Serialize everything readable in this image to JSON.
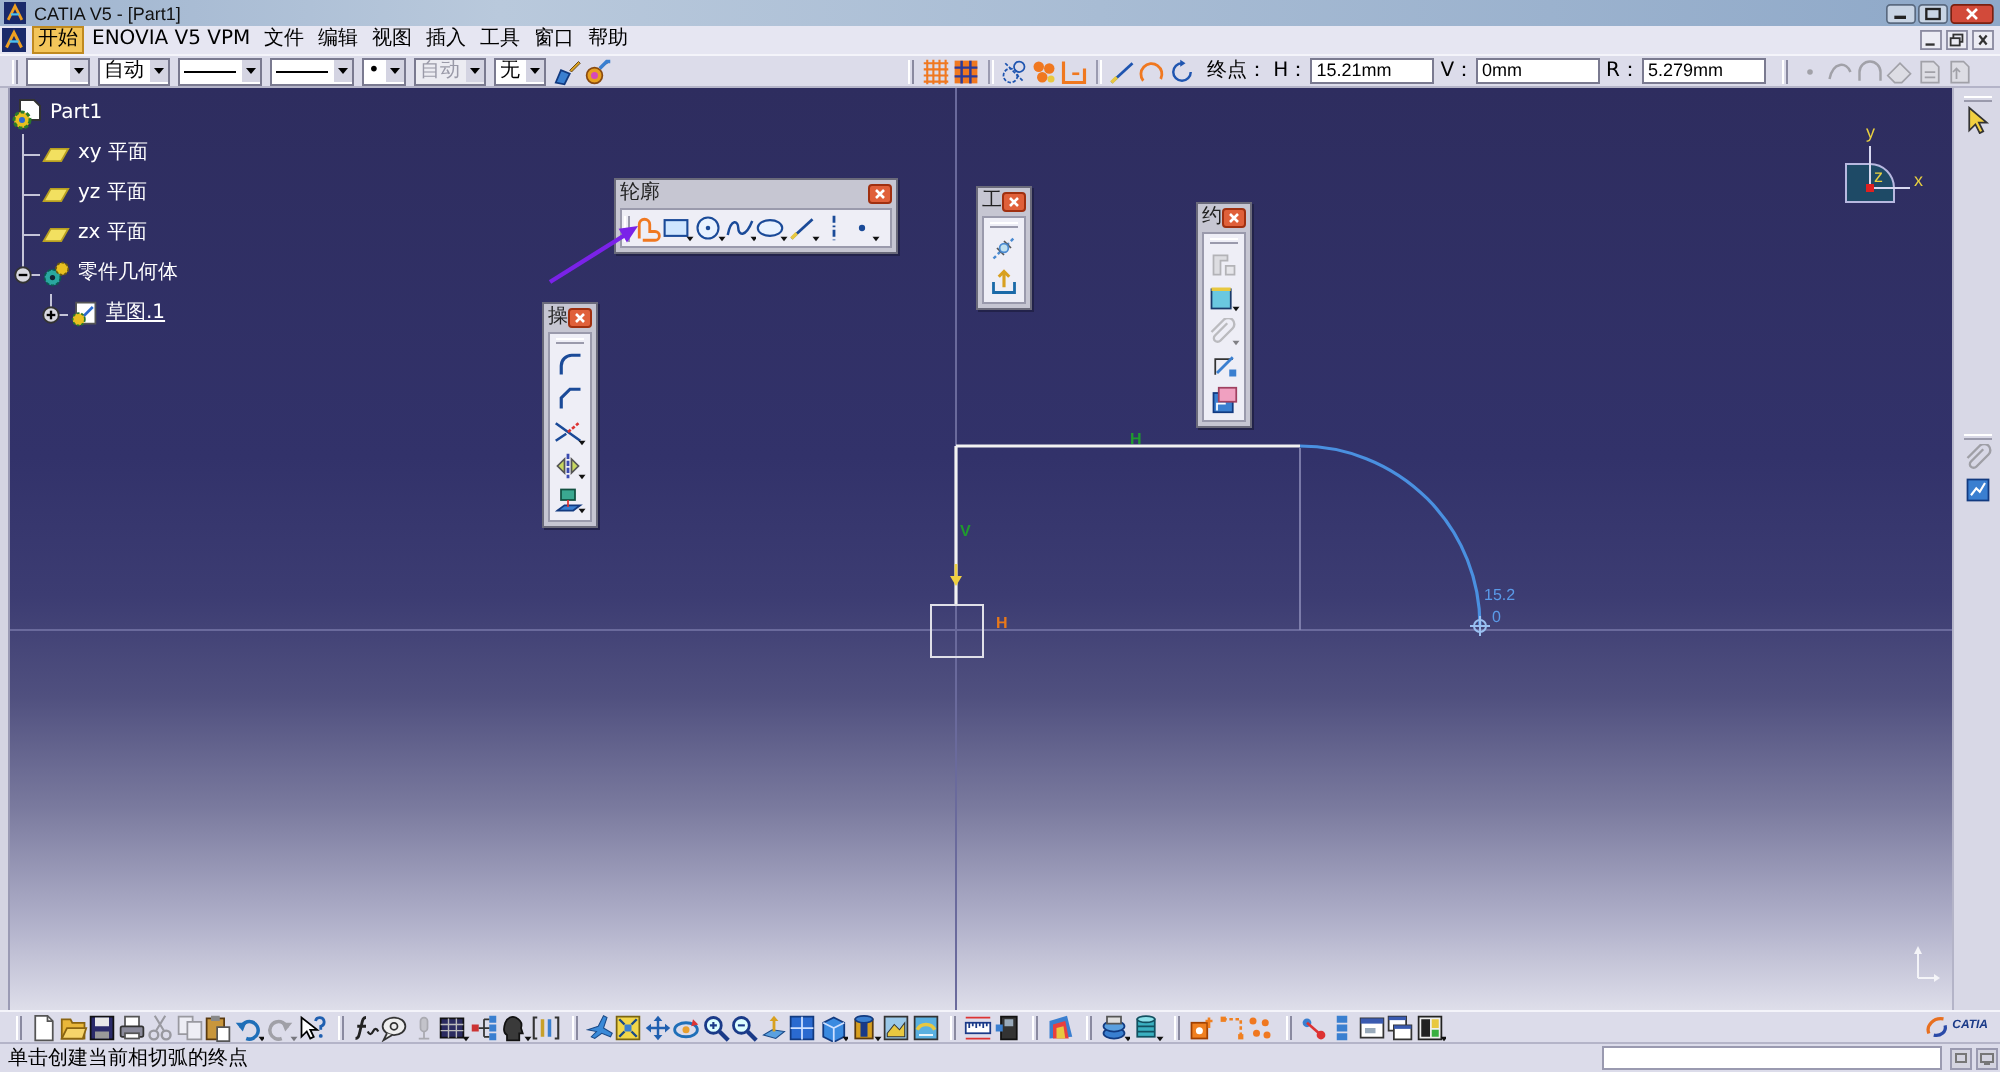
{
  "window": {
    "title": "CATIA V5 - [Part1]"
  },
  "menu_bar": {
    "items": [
      {
        "label": "开始",
        "selected": true
      },
      {
        "label": "ENOVIA V5 VPM",
        "selected": false
      },
      {
        "label": "文件",
        "selected": false
      },
      {
        "label": "编辑",
        "selected": false
      },
      {
        "label": "视图",
        "selected": false
      },
      {
        "label": "插入",
        "selected": false
      },
      {
        "label": "工具",
        "selected": false
      },
      {
        "label": "窗口",
        "selected": false
      },
      {
        "label": "帮助",
        "selected": false
      }
    ]
  },
  "properties_toolbar": {
    "dropdowns": [
      {
        "kind": "color",
        "disabled": false
      },
      {
        "kind": "text",
        "value": "自动",
        "disabled": false
      },
      {
        "kind": "line",
        "disabled": false
      },
      {
        "kind": "line",
        "disabled": false
      },
      {
        "kind": "text",
        "value": "•",
        "disabled": false
      },
      {
        "kind": "text",
        "value": "自动",
        "disabled": true
      },
      {
        "kind": "text",
        "value": "无",
        "disabled": false
      }
    ],
    "buttons": [
      {
        "kind": "brush"
      },
      {
        "kind": "painter"
      }
    ]
  },
  "sketch_tools_toolbar": {
    "groups": [
      {
        "buttons": [
          {
            "kind": "grid",
            "on": true
          },
          {
            "kind": "snap",
            "on": true
          }
        ]
      },
      {
        "buttons": [
          {
            "kind": "construction",
            "on": false
          },
          {
            "kind": "constraints",
            "on": true
          },
          {
            "kind": "dimensions",
            "on": true
          }
        ]
      },
      {
        "buttons": [
          {
            "kind": "line",
            "on": false
          },
          {
            "kind": "tangentarc",
            "on": true
          },
          {
            "kind": "threepointarc",
            "on": false
          }
        ]
      }
    ],
    "label": "终点：",
    "fields": [
      {
        "label": "H：",
        "value": "15.21mm"
      },
      {
        "label": "V：",
        "value": "0mm"
      },
      {
        "label": "R：",
        "value": "5.279mm"
      }
    ]
  },
  "edit_toolbar": {
    "buttons": [
      {
        "kind": "dot",
        "disabled": true
      },
      {
        "kind": "curve",
        "disabled": true
      },
      {
        "kind": "arch",
        "disabled": true
      },
      {
        "kind": "eraser",
        "disabled": true
      },
      {
        "kind": "pagefold",
        "disabled": true
      },
      {
        "kind": "pagearrow",
        "disabled": true
      }
    ]
  },
  "tree": {
    "label": "Part1",
    "kind": "part",
    "current": false,
    "children": [
      {
        "label": "xy 平面",
        "kind": "plane",
        "current": false
      },
      {
        "label": "yz 平面",
        "kind": "plane",
        "current": false
      },
      {
        "label": "zx 平面",
        "kind": "plane",
        "current": false
      },
      {
        "label": "零件几何体",
        "kind": "body",
        "current": false,
        "expanded": true,
        "children": [
          {
            "label": "草图.1",
            "kind": "sketch",
            "current": true,
            "expanded": false
          }
        ]
      }
    ]
  },
  "floating_toolbars": [
    {
      "title": "轮廓",
      "buttons": [
        {
          "kind": "profile",
          "selected": true
        },
        {
          "kind": "rectangle",
          "selected": false,
          "menu": true
        },
        {
          "kind": "circle",
          "selected": false,
          "menu": true
        },
        {
          "kind": "spline",
          "selected": false,
          "menu": true
        },
        {
          "kind": "ellipse",
          "selected": false,
          "menu": true
        },
        {
          "kind": "line",
          "selected": false,
          "menu": true
        },
        {
          "kind": "axis",
          "selected": false
        },
        {
          "kind": "point",
          "selected": false,
          "menu": true
        }
      ]
    },
    {
      "title": "工",
      "buttons": [
        {
          "kind": "constructionmode"
        },
        {
          "kind": "exit"
        }
      ]
    },
    {
      "title": "约",
      "buttons": [
        {
          "kind": "constraintdialog",
          "disabled": true
        },
        {
          "kind": "fixed",
          "disabled": false,
          "menu": true
        },
        {
          "kind": "contact",
          "disabled": true,
          "menu": true
        },
        {
          "kind": "editmulti",
          "disabled": false
        },
        {
          "kind": "autoconstraint",
          "disabled": false
        }
      ]
    },
    {
      "title": "操",
      "buttons": [
        {
          "kind": "fillet"
        },
        {
          "kind": "chamfer"
        },
        {
          "kind": "trim",
          "menu": true
        },
        {
          "kind": "mirror",
          "menu": true
        },
        {
          "kind": "project",
          "menu": true
        }
      ]
    }
  ],
  "sketch": {
    "constraints": [
      {
        "label": "H",
        "color": "#1f9a2e"
      },
      {
        "label": "V",
        "color": "#1f9a2e"
      },
      {
        "label": "H",
        "color": "#e8781a"
      }
    ],
    "readouts": [
      "15.2",
      "0"
    ]
  },
  "compass": {
    "x": "x",
    "y": "y",
    "z": "z"
  },
  "right_toolbar": {
    "groups": [
      {
        "buttons": [
          {
            "kind": "select",
            "disabled": false
          }
        ]
      },
      {
        "buttons": [
          {
            "kind": "clip",
            "disabled": true
          },
          {
            "kind": "analysis",
            "disabled": false
          }
        ]
      }
    ]
  },
  "bottom_toolbar": {
    "groups": [
      {
        "buttons": [
          {
            "kind": "new",
            "disabled": false
          },
          {
            "kind": "open",
            "disabled": false
          },
          {
            "kind": "save",
            "disabled": false
          },
          {
            "kind": "print",
            "disabled": false
          },
          {
            "kind": "cut",
            "disabled": true
          },
          {
            "kind": "copy",
            "disabled": true
          },
          {
            "kind": "paste",
            "disabled": false
          },
          {
            "kind": "undo",
            "disabled": false,
            "menu": true
          },
          {
            "kind": "redo",
            "disabled": true,
            "menu": true
          },
          {
            "kind": "whatsthis",
            "disabled": false
          }
        ]
      },
      {
        "buttons": [
          {
            "kind": "formula",
            "disabled": false
          },
          {
            "kind": "comment",
            "disabled": false
          },
          {
            "kind": "mic",
            "disabled": true
          },
          {
            "kind": "table",
            "disabled": false,
            "menu": true
          },
          {
            "kind": "network",
            "disabled": false
          },
          {
            "kind": "head",
            "disabled": false,
            "menu": true
          },
          {
            "kind": "split",
            "disabled": false
          }
        ]
      },
      {
        "buttons": [
          {
            "kind": "fly",
            "disabled": false
          },
          {
            "kind": "fitall",
            "disabled": false
          },
          {
            "kind": "pan",
            "disabled": false
          },
          {
            "kind": "rotate",
            "disabled": false
          },
          {
            "kind": "zoomin",
            "disabled": false
          },
          {
            "kind": "zoomout",
            "disabled": false
          },
          {
            "kind": "normal",
            "disabled": false
          },
          {
            "kind": "multiview",
            "disabled": false
          },
          {
            "kind": "cube",
            "disabled": false,
            "menu": true
          },
          {
            "kind": "shading",
            "disabled": false,
            "menu": true
          },
          {
            "kind": "hideshow",
            "disabled": false
          },
          {
            "kind": "swap",
            "disabled": false
          }
        ]
      },
      {
        "buttons": [
          {
            "kind": "measure",
            "disabled": false
          },
          {
            "kind": "device",
            "disabled": false
          }
        ]
      },
      {
        "buttons": [
          {
            "kind": "palette",
            "disabled": false
          }
        ]
      },
      {
        "buttons": [
          {
            "kind": "disk",
            "disabled": false,
            "menu": true
          },
          {
            "kind": "cylinders",
            "disabled": false,
            "menu": true
          }
        ]
      },
      {
        "buttons": [
          {
            "kind": "block",
            "disabled": false
          },
          {
            "kind": "corner",
            "disabled": false
          },
          {
            "kind": "points",
            "disabled": false
          }
        ]
      },
      {
        "buttons": [
          {
            "kind": "node",
            "disabled": false
          },
          {
            "kind": "bars",
            "disabled": false
          },
          {
            "kind": "window",
            "disabled": false
          },
          {
            "kind": "windows",
            "disabled": false
          },
          {
            "kind": "tiles",
            "disabled": false,
            "menu": true
          }
        ]
      }
    ]
  },
  "logo": {
    "text": "CATIA"
  },
  "status_bar": {
    "message": "单击创建当前相切弧的终点"
  }
}
